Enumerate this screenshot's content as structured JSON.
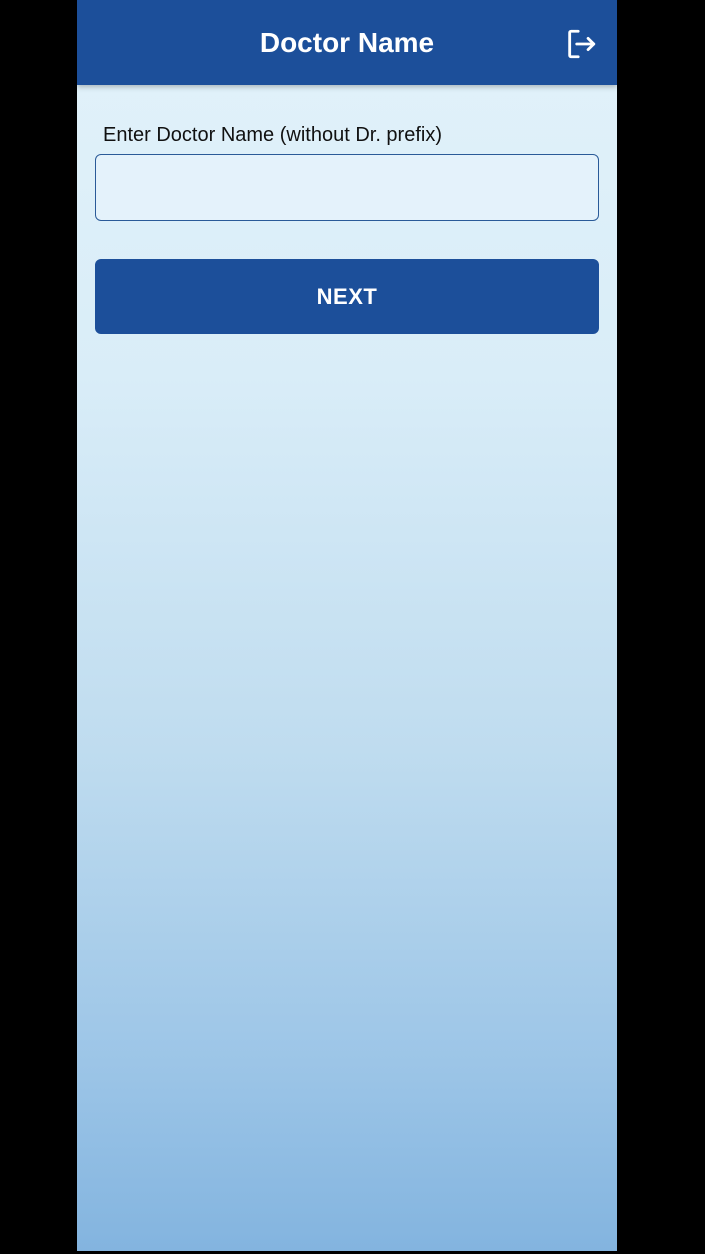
{
  "app_bar": {
    "title": "Doctor Name",
    "logout_icon": "logout-icon"
  },
  "form": {
    "label": "Enter Doctor Name (without Dr. prefix)",
    "input_value": "",
    "input_placeholder": "",
    "next_label": "NEXT"
  },
  "colors": {
    "primary": "#1c4f9a",
    "app_bar_text": "#ffffff",
    "background_top": "#e2f2fa",
    "background_bottom": "#83b4df"
  }
}
